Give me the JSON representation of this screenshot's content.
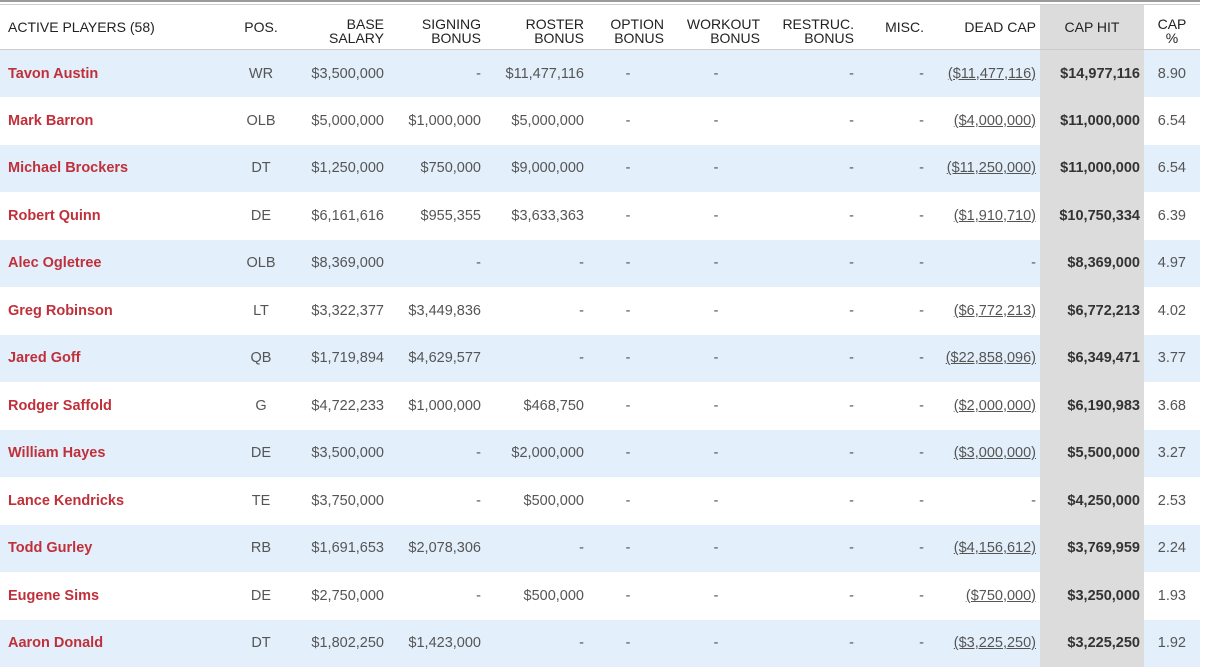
{
  "headers": {
    "players": "ACTIVE PLAYERS (58)",
    "pos": "POS.",
    "base_salary": [
      "BASE",
      "SALARY"
    ],
    "signing_bonus": [
      "SIGNING",
      "BONUS"
    ],
    "roster_bonus": [
      "ROSTER",
      "BONUS"
    ],
    "option_bonus": [
      "OPTION",
      "BONUS"
    ],
    "workout_bonus": [
      "WORKOUT",
      "BONUS"
    ],
    "restruc_bonus": [
      "RESTRUC.",
      "BONUS"
    ],
    "misc": "MISC.",
    "dead_cap": "DEAD CAP",
    "cap_hit": "CAP HIT",
    "cap_pct": [
      "CAP",
      "%"
    ]
  },
  "rows": [
    {
      "name": "Tavon Austin",
      "pos": "WR",
      "base": "$3,500,000",
      "signing": "-",
      "roster": "$11,477,116",
      "option": "-",
      "workout": "-",
      "restruc": "-",
      "misc": "-",
      "dead": "($11,477,116)",
      "hit": "$14,977,116",
      "pct": "8.90"
    },
    {
      "name": "Mark Barron",
      "pos": "OLB",
      "base": "$5,000,000",
      "signing": "$1,000,000",
      "roster": "$5,000,000",
      "option": "-",
      "workout": "-",
      "restruc": "-",
      "misc": "-",
      "dead": "($4,000,000)",
      "hit": "$11,000,000",
      "pct": "6.54"
    },
    {
      "name": "Michael Brockers",
      "pos": "DT",
      "base": "$1,250,000",
      "signing": "$750,000",
      "roster": "$9,000,000",
      "option": "-",
      "workout": "-",
      "restruc": "-",
      "misc": "-",
      "dead": "($11,250,000)",
      "hit": "$11,000,000",
      "pct": "6.54"
    },
    {
      "name": "Robert Quinn",
      "pos": "DE",
      "base": "$6,161,616",
      "signing": "$955,355",
      "roster": "$3,633,363",
      "option": "-",
      "workout": "-",
      "restruc": "-",
      "misc": "-",
      "dead": "($1,910,710)",
      "hit": "$10,750,334",
      "pct": "6.39"
    },
    {
      "name": "Alec Ogletree",
      "pos": "OLB",
      "base": "$8,369,000",
      "signing": "-",
      "roster": "-",
      "option": "-",
      "workout": "-",
      "restruc": "-",
      "misc": "-",
      "dead": "-",
      "hit": "$8,369,000",
      "pct": "4.97"
    },
    {
      "name": "Greg Robinson",
      "pos": "LT",
      "base": "$3,322,377",
      "signing": "$3,449,836",
      "roster": "-",
      "option": "-",
      "workout": "-",
      "restruc": "-",
      "misc": "-",
      "dead": "($6,772,213)",
      "hit": "$6,772,213",
      "pct": "4.02"
    },
    {
      "name": "Jared Goff",
      "pos": "QB",
      "base": "$1,719,894",
      "signing": "$4,629,577",
      "roster": "-",
      "option": "-",
      "workout": "-",
      "restruc": "-",
      "misc": "-",
      "dead": "($22,858,096)",
      "hit": "$6,349,471",
      "pct": "3.77"
    },
    {
      "name": "Rodger Saffold",
      "pos": "G",
      "base": "$4,722,233",
      "signing": "$1,000,000",
      "roster": "$468,750",
      "option": "-",
      "workout": "-",
      "restruc": "-",
      "misc": "-",
      "dead": "($2,000,000)",
      "hit": "$6,190,983",
      "pct": "3.68"
    },
    {
      "name": "William Hayes",
      "pos": "DE",
      "base": "$3,500,000",
      "signing": "-",
      "roster": "$2,000,000",
      "option": "-",
      "workout": "-",
      "restruc": "-",
      "misc": "-",
      "dead": "($3,000,000)",
      "hit": "$5,500,000",
      "pct": "3.27"
    },
    {
      "name": "Lance Kendricks",
      "pos": "TE",
      "base": "$3,750,000",
      "signing": "-",
      "roster": "$500,000",
      "option": "-",
      "workout": "-",
      "restruc": "-",
      "misc": "-",
      "dead": "-",
      "hit": "$4,250,000",
      "pct": "2.53"
    },
    {
      "name": "Todd Gurley",
      "pos": "RB",
      "base": "$1,691,653",
      "signing": "$2,078,306",
      "roster": "-",
      "option": "-",
      "workout": "-",
      "restruc": "-",
      "misc": "-",
      "dead": "($4,156,612)",
      "hit": "$3,769,959",
      "pct": "2.24"
    },
    {
      "name": "Eugene Sims",
      "pos": "DE",
      "base": "$2,750,000",
      "signing": "-",
      "roster": "$500,000",
      "option": "-",
      "workout": "-",
      "restruc": "-",
      "misc": "-",
      "dead": "($750,000)",
      "hit": "$3,250,000",
      "pct": "1.93"
    },
    {
      "name": "Aaron Donald",
      "pos": "DT",
      "base": "$1,802,250",
      "signing": "$1,423,000",
      "roster": "-",
      "option": "-",
      "workout": "-",
      "restruc": "-",
      "misc": "-",
      "dead": "($3,225,250)",
      "hit": "$3,225,250",
      "pct": "1.92"
    }
  ],
  "colors": {
    "row_alt": "#e3effb",
    "cap_hit_bg": "#dcdcdc",
    "player_name": "#c0303a"
  }
}
